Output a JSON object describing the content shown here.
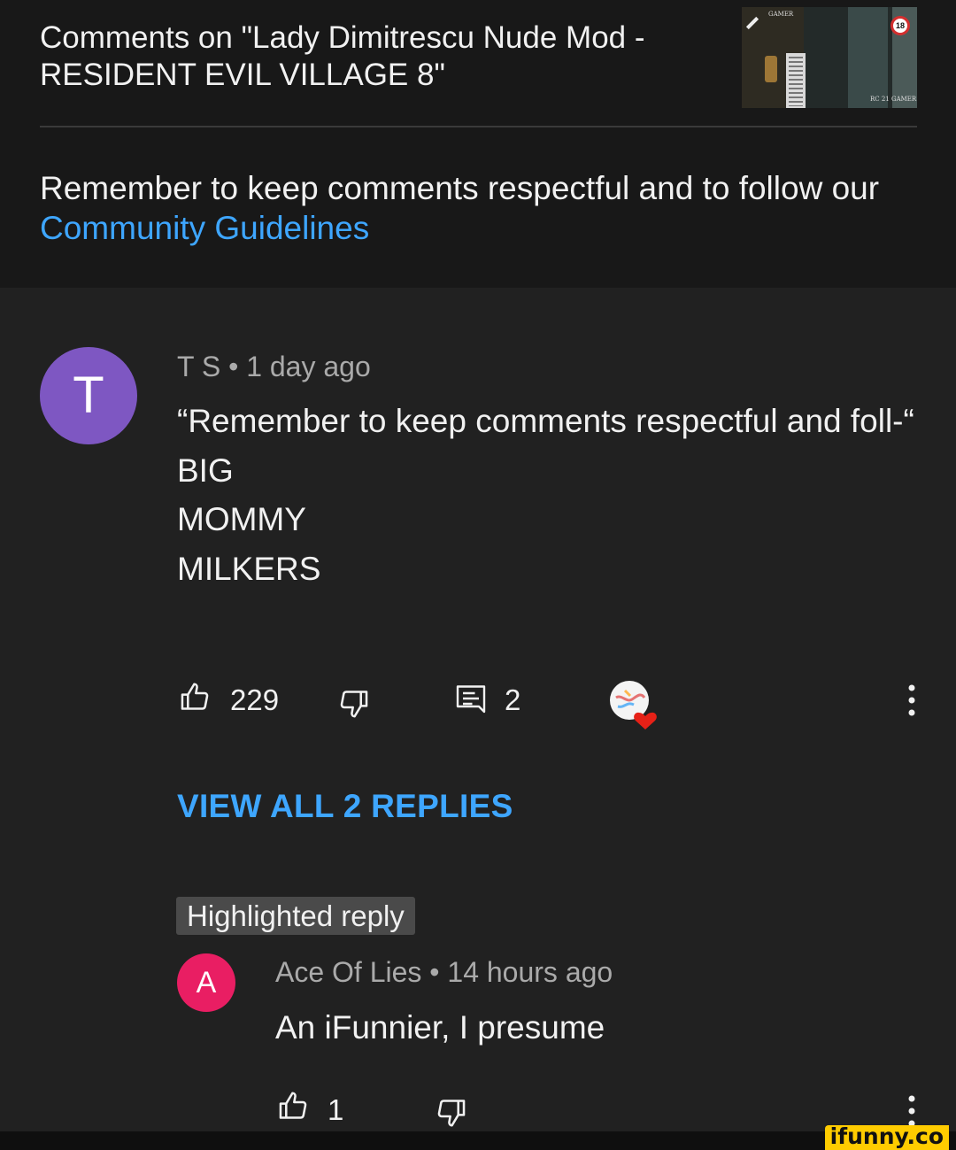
{
  "header": {
    "title": "Comments on \"Lady Dimitrescu Nude Mod - RESIDENT EVIL VILLAGE 8\"",
    "thumbnail": {
      "badge": "18",
      "channel_text_top": "GAMER",
      "channel_text_bottom": "RC 21 GAMER"
    }
  },
  "notice": {
    "text": "Remember to keep comments respectful and to follow our ",
    "link": "Community Guidelines"
  },
  "comment": {
    "avatar_letter": "T",
    "author": "T S",
    "separator": "•",
    "time": "1 day ago",
    "lines": [
      "“Remember to keep comments respectful and foll-“",
      "BIG",
      "MOMMY",
      "MILKERS"
    ],
    "likes": "229",
    "replies_count": "2",
    "view_replies": "VIEW ALL 2 REPLIES"
  },
  "highlighted_reply": {
    "badge": "Highlighted reply",
    "avatar_letter": "A",
    "author": "Ace Of Lies",
    "separator": "•",
    "time": "14 hours ago",
    "text": "An iFunnier, I presume",
    "likes": "1"
  },
  "watermark": "ifunny.co",
  "colors": {
    "header_bg": "#181818",
    "body_bg": "#212121",
    "link": "#3ea6ff",
    "avatar_main": "#7e57c2",
    "avatar_reply": "#e91e63",
    "heart": "#e62117"
  },
  "icons": [
    "like-icon",
    "dislike-icon",
    "reply-icon",
    "creator-heart-icon",
    "more-vert-icon"
  ]
}
